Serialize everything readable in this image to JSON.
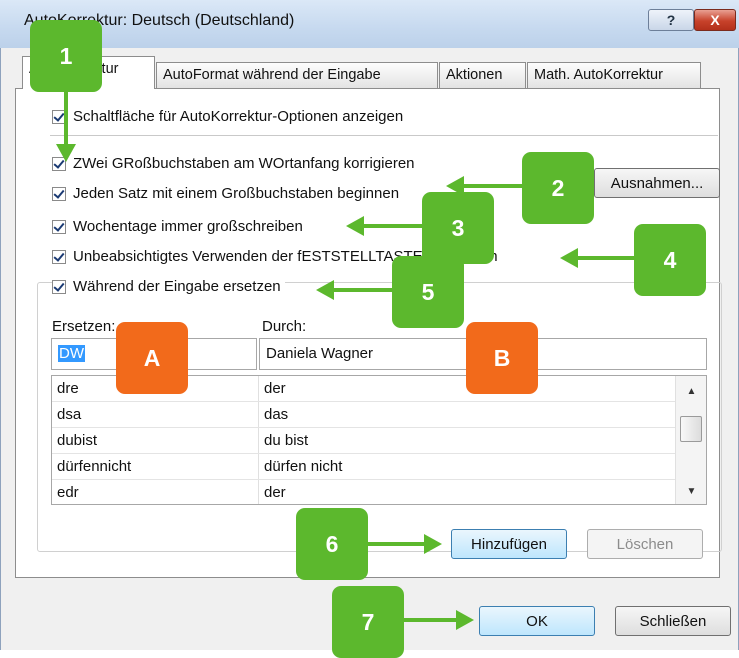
{
  "window": {
    "title": "AutoKorrektur: Deutsch (Deutschland)",
    "help_label": "?",
    "close_label": "X"
  },
  "tabs": [
    {
      "label": "AutoKorrektur",
      "active": true
    },
    {
      "label": "AutoFormat während der Eingabe",
      "active": false
    },
    {
      "label": "Aktionen",
      "active": false
    },
    {
      "label": "Math. AutoKorrektur",
      "active": false
    }
  ],
  "options": {
    "show_buttons": {
      "label": "Schaltfläche für AutoKorrektur-Optionen anzeigen",
      "checked": true
    },
    "two_initial_caps": {
      "label": "ZWei GRoßbuchstaben am WOrtanfang korrigieren",
      "checked": true
    },
    "capitalize_sentence": {
      "label": "Jeden Satz mit einem Großbuchstaben beginnen",
      "checked": true
    },
    "capitalize_days": {
      "label": "Wochentage immer großschreiben",
      "checked": true
    },
    "caps_lock": {
      "label": "Unbeabsichtigtes Verwenden der fESTSTELLTASTE korrigieren",
      "checked": true
    },
    "replace_typing": {
      "label": "Während der Eingabe ersetzen",
      "checked": true
    }
  },
  "exceptions_button": "Ausnahmen...",
  "replace": {
    "replace_label": "Ersetzen:",
    "with_label": "Durch:",
    "replace_value": "DW",
    "with_value": "Daniela Wagner",
    "entries": [
      {
        "from": "dre",
        "to": "der"
      },
      {
        "from": "dsa",
        "to": "das"
      },
      {
        "from": "dubist",
        "to": "du bist"
      },
      {
        "from": "dürfennicht",
        "to": "dürfen nicht"
      },
      {
        "from": "edr",
        "to": "der"
      }
    ]
  },
  "buttons": {
    "add": "Hinzufügen",
    "delete": "Löschen",
    "ok": "OK",
    "close": "Schließen"
  },
  "annotations": {
    "badge_1": "1",
    "badge_2": "2",
    "badge_3": "3",
    "badge_4": "4",
    "badge_5": "5",
    "badge_6": "6",
    "badge_7": "7",
    "badge_a": "A",
    "badge_b": "B",
    "green_color": "#5cb82d",
    "orange_color": "#f26a1b"
  }
}
